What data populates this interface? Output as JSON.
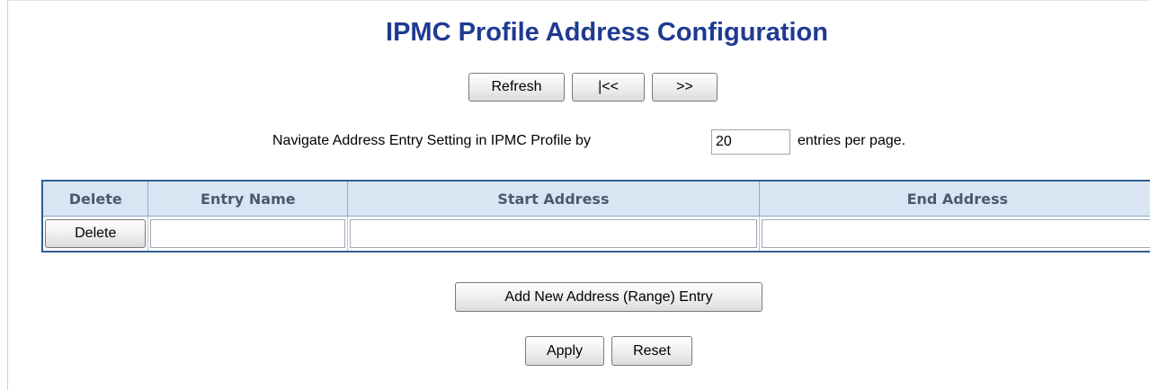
{
  "page": {
    "title": "IPMC Profile Address Configuration"
  },
  "nav_buttons": {
    "refresh": "Refresh",
    "first": "|<<",
    "next": ">>"
  },
  "pagination": {
    "prefix": "Navigate Address Entry Setting in IPMC Profile by",
    "entries_value": "20",
    "suffix": "entries per page."
  },
  "table": {
    "headers": [
      "Delete",
      "Entry Name",
      "Start Address",
      "End Address"
    ],
    "rows": [
      {
        "delete_label": "Delete",
        "entry_name": "",
        "start_address": "",
        "end_address": ""
      }
    ]
  },
  "actions": {
    "add_entry": "Add New Address (Range) Entry",
    "apply": "Apply",
    "reset": "Reset"
  }
}
